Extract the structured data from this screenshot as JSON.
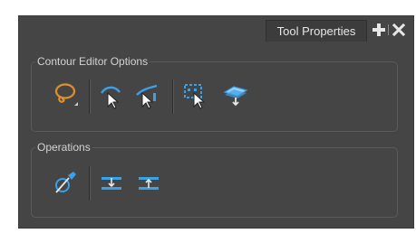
{
  "panel": {
    "tab_label": "Tool Properties",
    "add_icon": "plus-icon",
    "close_icon": "close-icon"
  },
  "contour_editor_options": {
    "title": "Contour Editor Options",
    "tools": [
      {
        "icon": "lasso-select-icon"
      },
      {
        "icon": "contour-editor-pen-icon"
      },
      {
        "icon": "contour-editor-pen-alt-icon"
      },
      {
        "icon": "select-points-icon"
      },
      {
        "icon": "layer-flatten-icon"
      }
    ]
  },
  "operations": {
    "title": "Operations",
    "tools": [
      {
        "icon": "create-point-icon"
      },
      {
        "icon": "distribute-horizontal-icon"
      },
      {
        "icon": "distribute-vertical-icon"
      }
    ]
  },
  "colors": {
    "panel_bg": "#454545",
    "accent_blue": "#3aa0e8",
    "accent_orange": "#e0902a"
  }
}
